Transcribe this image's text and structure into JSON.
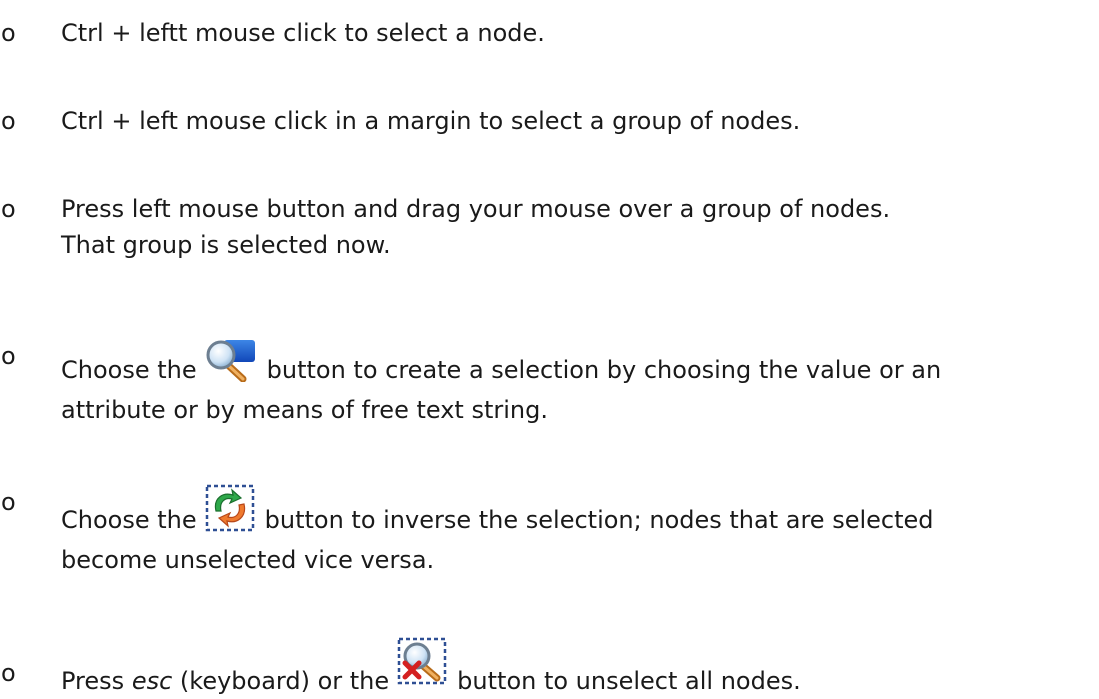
{
  "bullet_glyph": "o",
  "items": [
    {
      "line1": "Ctrl + leftt mouse click to select a node."
    },
    {
      "line1": "Ctrl + left mouse click in a margin to select a group of nodes."
    },
    {
      "line1": "Press left mouse button and drag your mouse over a group of nodes.",
      "line2": "That group is selected now."
    },
    {
      "before": "Choose the",
      "icon": "search-selection-icon",
      "after": "button to create a selection by choosing the value or an",
      "line2": "attribute or by means of free text string."
    },
    {
      "before": "Choose the",
      "icon": "inverse-selection-icon",
      "after": "button to inverse the selection; nodes that are selected",
      "line2": "become unselected vice versa."
    },
    {
      "before": "Press",
      "kbd": "esc",
      "mid": "(keyboard) or the",
      "icon": "unselect-all-icon",
      "after": "button to unselect all nodes."
    }
  ]
}
